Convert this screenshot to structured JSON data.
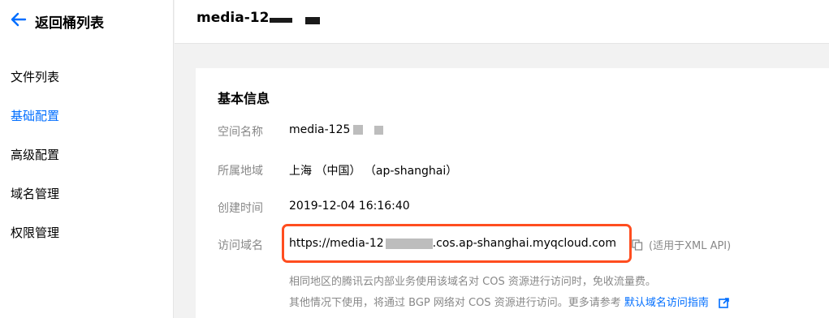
{
  "sidebar": {
    "back_label": "返回桶列表",
    "items": [
      {
        "label": "文件列表"
      },
      {
        "label": "基础配置",
        "active": true
      },
      {
        "label": "高级配置"
      },
      {
        "label": "域名管理"
      },
      {
        "label": "权限管理"
      }
    ]
  },
  "header": {
    "bucket_title": "media-12"
  },
  "card": {
    "section_title": "基本信息",
    "rows": [
      {
        "label": "空间名称",
        "value": "media-125"
      },
      {
        "label": "所属地域",
        "value": "上海 （中国） （ap-shanghai）"
      },
      {
        "label": "创建时间",
        "value": "2019-12-04 16:16:40"
      },
      {
        "label": "访问域名",
        "value_prefix": "https://media-12",
        "value_suffix": ".cos.ap-shanghai.myqcloud.com"
      }
    ],
    "api_note": "(适用于XML API)",
    "desc_line1": "相同地区的腾讯云内部业务使用该域名对 COS 资源进行访问时，免收流量费。",
    "desc_line2_text": "其他情况下使用，将通过 BGP 网络对 COS 资源进行访问。更多请参考",
    "desc_line2_link": "默认域名访问指南"
  },
  "colors": {
    "accent": "#006eff",
    "highlight_border": "#ff4d1f",
    "muted_text": "#888888"
  },
  "icons": [
    "arrow-left-icon",
    "copy-icon",
    "external-link-icon"
  ]
}
